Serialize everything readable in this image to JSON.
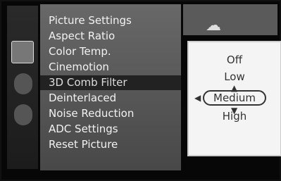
{
  "menu": {
    "items": [
      {
        "label": "Picture Settings"
      },
      {
        "label": "Aspect Ratio"
      },
      {
        "label": "Color Temp."
      },
      {
        "label": "Cinemotion"
      },
      {
        "label": "3D Comb Filter"
      },
      {
        "label": "Deinterlaced"
      },
      {
        "label": "Noise Reduction"
      },
      {
        "label": "ADC Settings"
      },
      {
        "label": "Reset Picture"
      }
    ],
    "selected_index": 4
  },
  "popup": {
    "options": [
      "Off",
      "Low",
      "Medium",
      "High"
    ],
    "selected": "Medium",
    "arrow_up": "▲",
    "arrow_down": "▼",
    "arrow_left": "◀"
  },
  "icons": {
    "top_icon": "☁"
  }
}
